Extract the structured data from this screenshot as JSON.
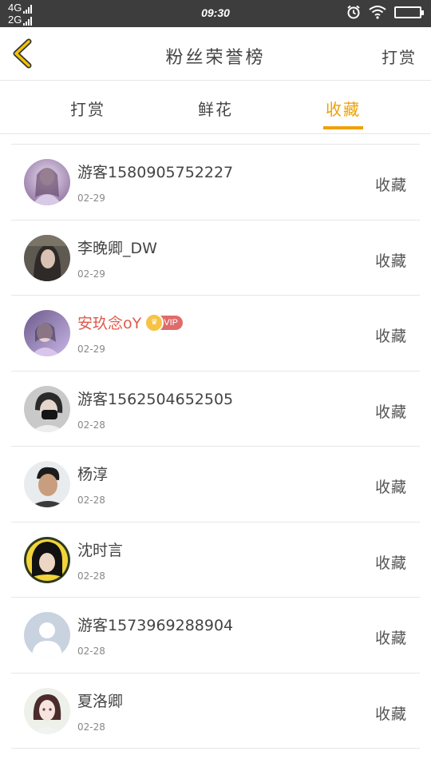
{
  "status_bar": {
    "network_top": "4G",
    "network_bottom": "2G",
    "time": "09:30"
  },
  "nav": {
    "title": "粉丝荣誉榜",
    "right_label": "打赏"
  },
  "tabs": [
    {
      "label": "打赏",
      "active": false
    },
    {
      "label": "鲜花",
      "active": false
    },
    {
      "label": "收藏",
      "active": true
    }
  ],
  "accent_color": "#f0a000",
  "list": [
    {
      "name": "游客1580905752227",
      "date": "02-29",
      "action": "收藏",
      "vip": false
    },
    {
      "name": "李晚卿_DW",
      "date": "02-29",
      "action": "收藏",
      "vip": false
    },
    {
      "name": "安玖念oY",
      "date": "02-29",
      "action": "收藏",
      "vip": true,
      "badge": "VIP"
    },
    {
      "name": "游客1562504652505",
      "date": "02-28",
      "action": "收藏",
      "vip": false
    },
    {
      "name": "杨淳",
      "date": "02-28",
      "action": "收藏",
      "vip": false
    },
    {
      "name": "沈时言",
      "date": "02-28",
      "action": "收藏",
      "vip": false
    },
    {
      "name": "游客1573969288904",
      "date": "02-28",
      "action": "收藏",
      "vip": false
    },
    {
      "name": "夏洛卿",
      "date": "02-28",
      "action": "收藏",
      "vip": false
    }
  ]
}
